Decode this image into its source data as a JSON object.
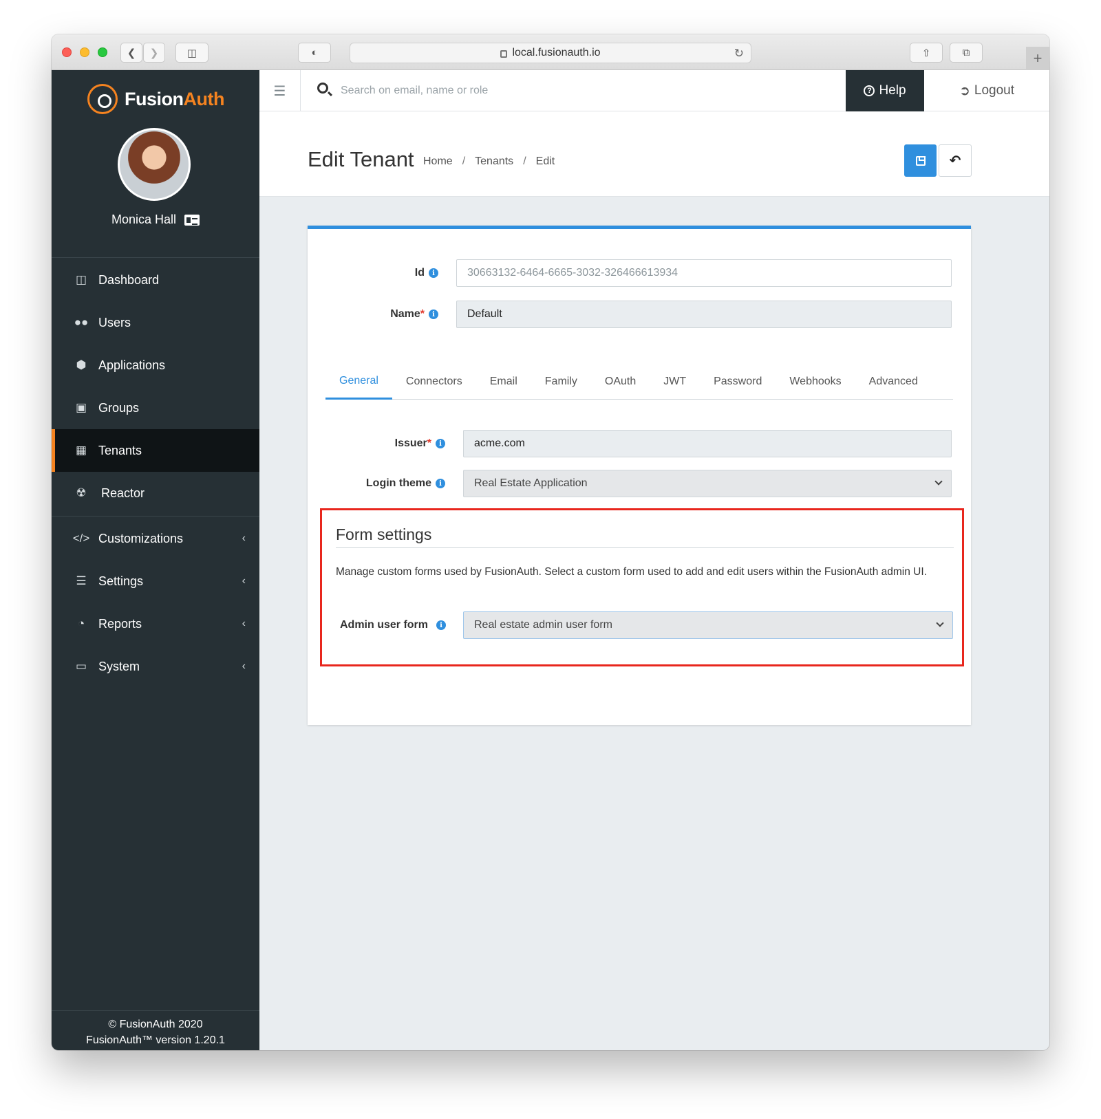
{
  "browser": {
    "url": "local.fusionauth.io"
  },
  "sidebar": {
    "logo": {
      "part1": "Fusion",
      "part2": "Auth"
    },
    "user_name": "Monica Hall",
    "items": [
      {
        "label": "Dashboard",
        "icon": "columns-icon"
      },
      {
        "label": "Users",
        "icon": "users-icon"
      },
      {
        "label": "Applications",
        "icon": "cube-icon"
      },
      {
        "label": "Groups",
        "icon": "object-group-icon"
      },
      {
        "label": "Tenants",
        "icon": "building-icon",
        "active": true
      },
      {
        "label": "Reactor",
        "icon": "radiation-icon"
      },
      {
        "label": "Customizations",
        "icon": "code-icon",
        "chevron": "‹"
      },
      {
        "label": "Settings",
        "icon": "sliders-icon",
        "chevron": "‹"
      },
      {
        "label": "Reports",
        "icon": "pie-chart-icon",
        "chevron": "‹"
      },
      {
        "label": "System",
        "icon": "desktop-icon",
        "chevron": "‹"
      }
    ],
    "footer": {
      "copyright": "© FusionAuth 2020",
      "version": "FusionAuth™ version 1.20.1"
    }
  },
  "topbar": {
    "search_placeholder": "Search on email, name or role",
    "help_label": "Help",
    "logout_label": "Logout"
  },
  "header": {
    "title": "Edit Tenant",
    "breadcrumbs": [
      "Home",
      "Tenants",
      "Edit"
    ],
    "separator": "/"
  },
  "form": {
    "id_label": "Id",
    "id_value": "30663132-6464-6665-3032-326466613934",
    "name_label": "Name",
    "name_value": "Default",
    "required_mark": "*",
    "tabs": [
      "General",
      "Connectors",
      "Email",
      "Family",
      "OAuth",
      "JWT",
      "Password",
      "Webhooks",
      "Advanced"
    ],
    "active_tab": "General",
    "issuer_label": "Issuer",
    "issuer_value": "acme.com",
    "login_theme_label": "Login theme",
    "login_theme_value": "Real Estate Application",
    "form_settings": {
      "title": "Form settings",
      "description": "Manage custom forms used by FusionAuth. Select a custom form used to add and edit users within the FusionAuth admin UI.",
      "admin_user_form_label": "Admin user form",
      "admin_user_form_value": "Real estate admin user form"
    }
  },
  "colors": {
    "accent": "#2f8fde",
    "brand": "#f58320",
    "sidebar": "#263035",
    "highlight": "#e8261d"
  }
}
